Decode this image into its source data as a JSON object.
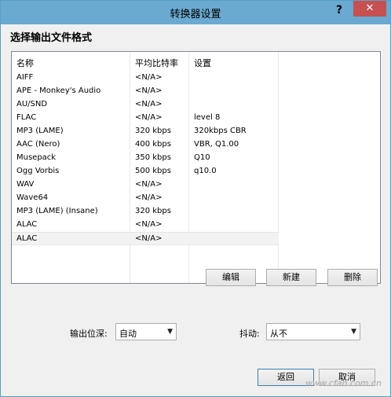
{
  "window": {
    "title": "转换器设置",
    "help_glyph": "?",
    "close_glyph": "✕"
  },
  "heading": "选择输出文件格式",
  "columns": [
    "名称",
    "平均比特率",
    "设置"
  ],
  "rows": [
    [
      "AIFF",
      "<N/A>",
      ""
    ],
    [
      "APE - Monkey's Audio",
      "<N/A>",
      ""
    ],
    [
      "AU/SND",
      "<N/A>",
      ""
    ],
    [
      "FLAC",
      "<N/A>",
      "level 8"
    ],
    [
      "MP3 (LAME)",
      "320 kbps",
      "320kbps CBR"
    ],
    [
      "AAC (Nero)",
      "400 kbps",
      "VBR, Q1.00"
    ],
    [
      "Musepack",
      "350 kbps",
      "Q10"
    ],
    [
      "Ogg Vorbis",
      "500 kbps",
      "q10.0"
    ],
    [
      "WAV",
      "<N/A>",
      ""
    ],
    [
      "Wave64",
      "<N/A>",
      ""
    ],
    [
      "MP3 (LAME) (Insane)",
      "320 kbps",
      ""
    ],
    [
      "ALAC",
      "<N/A>",
      ""
    ],
    [
      "ALAC",
      "<N/A>",
      ""
    ]
  ],
  "buttons": {
    "edit": "编辑",
    "new": "新建",
    "delete": "删除",
    "back": "返回",
    "cancel": "取消"
  },
  "output_depth": {
    "label": "输出位深:",
    "value": "自动"
  },
  "dither": {
    "label": "抖动:",
    "value": "从不"
  },
  "watermark": "www.cfan.com.cn"
}
